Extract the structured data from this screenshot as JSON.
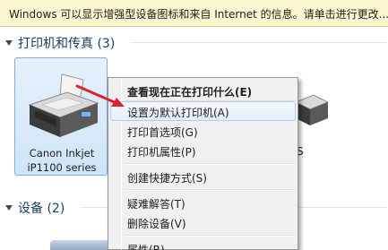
{
  "infobar": {
    "text": "Windows 可以显示增强型设备图标和来自 Internet 的信息。请单击进行更改..."
  },
  "groups": {
    "printers": {
      "label": "打印机和传真 (3)"
    },
    "devices": {
      "label": "设备 (2)"
    }
  },
  "selected_device": {
    "line1": "Canon Inkjet",
    "line2": "iP1100 series"
  },
  "partial_label": "S",
  "context_menu": {
    "items": [
      {
        "label": "查看现在正在打印什么(E)"
      },
      {
        "label": "设置为默认打印机(A)"
      },
      {
        "label": "打印首选项(G)"
      },
      {
        "label": "打印机属性(P)"
      },
      {
        "label": "创建快捷方式(S)"
      },
      {
        "label": "疑难解答(T)"
      },
      {
        "label": "删除设备(V)"
      },
      {
        "label": "属性(R)"
      }
    ]
  },
  "colors": {
    "accent_arrow": "#e0202a",
    "selection": "#cfe4f8",
    "infobar_bg": "#fcf6d0"
  }
}
